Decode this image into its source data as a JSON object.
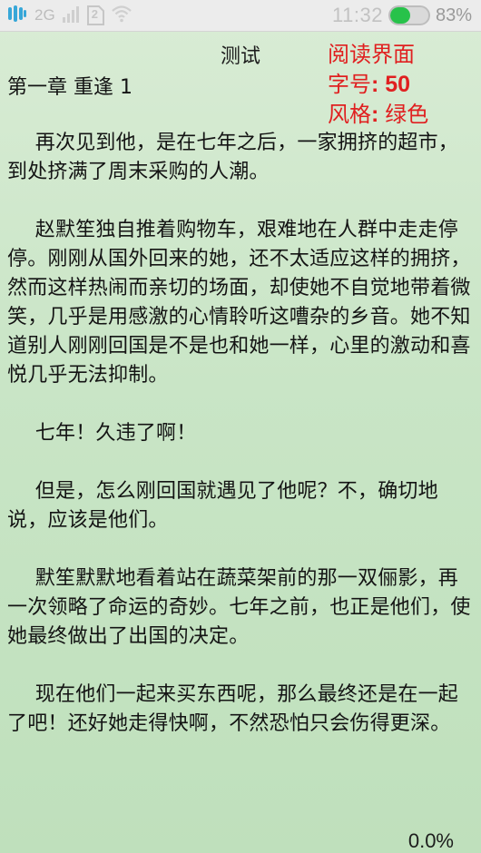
{
  "status_bar": {
    "network": "2G",
    "sim": "2",
    "time": "11:32",
    "battery": "83%",
    "battery_level": 0.83,
    "icons": [
      "app-menu-icon",
      "signal-icon",
      "sim-icon",
      "wifi-icon",
      "battery-icon"
    ]
  },
  "reader": {
    "title": "测试",
    "chapter": "第一章  重逢 1",
    "info": {
      "mode": "阅读界面",
      "font_size_label": "字号",
      "font_size_value": "50",
      "style_label": "风格",
      "style_value": "绿色"
    },
    "paragraphs": [
      "再次见到他，是在七年之后，一家拥挤的超市，到处挤满了周末采购的人潮。",
      "赵默笙独自推着购物车，艰难地在人群中走走停停。刚刚从国外回来的她，还不太适应这样的拥挤，然而这样热闹而亲切的场面，却使她不自觉地带着微笑，几乎是用感激的心情聆听这嘈杂的乡音。她不知道别人刚刚回国是不是也和她一样，心里的激动和喜悦几乎无法抑制。",
      "七年！久违了啊！",
      "但是，怎么刚回国就遇见了他呢？不，确切地说，应该是他们。",
      "默笙默默地看着站在蔬菜架前的那一双俪影，再一次领略了命运的奇妙。七年之前，也正是他们，使她最终做出了出国的决定。",
      "现在他们一起来买东西呢，那么最终还是在一起了吧！还好她走得快啊，不然恐怕只会伤得更深。"
    ],
    "progress": "0.0%"
  },
  "colors": {
    "background": "#c9e5c6",
    "info_text": "#e02020",
    "battery_fill": "#27c24a"
  }
}
